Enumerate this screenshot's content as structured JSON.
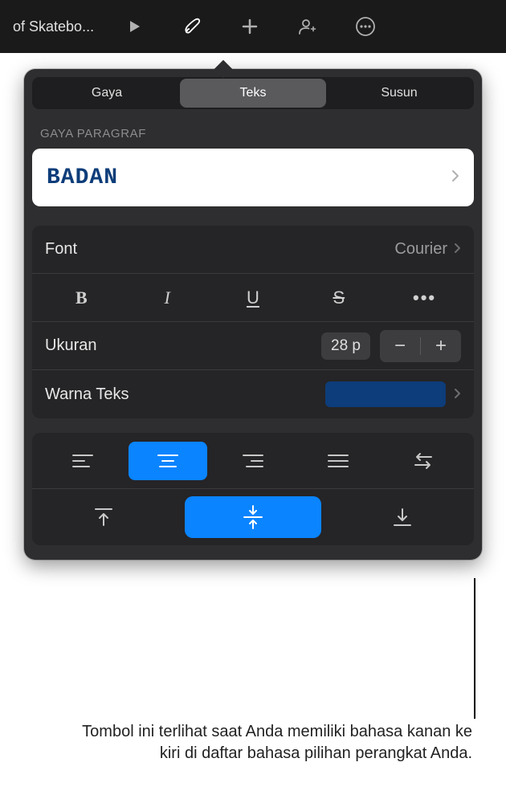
{
  "toolbar": {
    "title": "of Skatebo..."
  },
  "tabs": {
    "style": "Gaya",
    "text": "Teks",
    "arrange": "Susun"
  },
  "section": {
    "paragraph_style": "GAYA PARAGRAF"
  },
  "paragraph": {
    "current": "BADAN"
  },
  "font": {
    "label": "Font",
    "value": "Courier",
    "bold_glyph": "B",
    "italic_glyph": "I",
    "underline_glyph": "U",
    "strike_glyph": "S",
    "more_glyph": "•••"
  },
  "size": {
    "label": "Ukuran",
    "value": "28 p",
    "minus": "−",
    "plus": "+"
  },
  "textcolor": {
    "label": "Warna Teks",
    "hex": "#0d3d7a"
  },
  "callout": {
    "text": "Tombol ini terlihat saat Anda memiliki bahasa kanan ke kiri di daftar bahasa pilihan perangkat Anda."
  }
}
